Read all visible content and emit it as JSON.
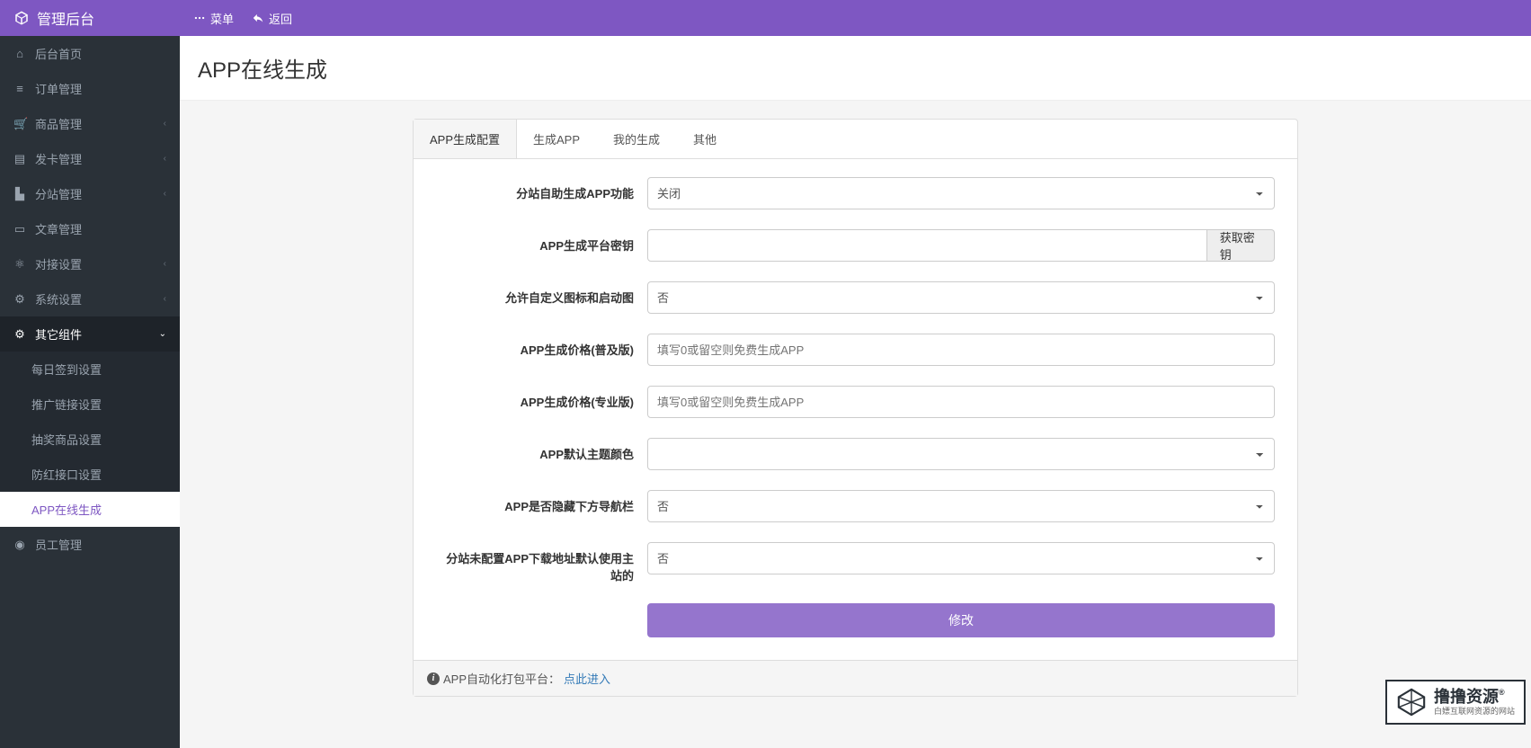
{
  "header": {
    "brand": "管理后台",
    "menu_btn": "菜单",
    "back_btn": "返回"
  },
  "sidebar": {
    "items": [
      {
        "label": "后台首页",
        "icon": "home"
      },
      {
        "label": "订单管理",
        "icon": "list"
      },
      {
        "label": "商品管理",
        "icon": "cart",
        "chev": true
      },
      {
        "label": "发卡管理",
        "icon": "card",
        "chev": true
      },
      {
        "label": "分站管理",
        "icon": "site",
        "chev": true
      },
      {
        "label": "文章管理",
        "icon": "doc"
      },
      {
        "label": "对接设置",
        "icon": "link",
        "chev": true
      },
      {
        "label": "系统设置",
        "icon": "gear",
        "chev": true
      },
      {
        "label": "其它组件",
        "icon": "cogs",
        "chev_down": true,
        "active": true
      },
      {
        "label": "员工管理",
        "icon": "user"
      }
    ],
    "sub_items": [
      {
        "label": "每日签到设置"
      },
      {
        "label": "推广链接设置"
      },
      {
        "label": "抽奖商品设置"
      },
      {
        "label": "防红接口设置"
      },
      {
        "label": "APP在线生成",
        "active": true
      }
    ]
  },
  "page": {
    "title": "APP在线生成"
  },
  "tabs": [
    {
      "label": "APP生成配置",
      "active": true
    },
    {
      "label": "生成APP"
    },
    {
      "label": "我的生成"
    },
    {
      "label": "其他"
    }
  ],
  "form": {
    "self_gen_label": "分站自助生成APP功能",
    "self_gen_value": "关闭",
    "key_label": "APP生成平台密钥",
    "key_value": "",
    "key_btn": "获取密钥",
    "custom_icon_label": "允许自定义图标和启动图",
    "custom_icon_value": "否",
    "price_basic_label": "APP生成价格(普及版)",
    "price_basic_placeholder": "填写0或留空则免费生成APP",
    "price_pro_label": "APP生成价格(专业版)",
    "price_pro_placeholder": "填写0或留空则免费生成APP",
    "theme_label": "APP默认主题颜色",
    "theme_value": "",
    "hide_nav_label": "APP是否隐藏下方导航栏",
    "hide_nav_value": "否",
    "fallback_label": "分站未配置APP下载地址默认使用主站的",
    "fallback_value": "否",
    "submit": "修改"
  },
  "footnote": {
    "prefix": "APP自动化打包平台：",
    "link": "点此进入"
  },
  "watermark": {
    "main": "撸撸资源",
    "r": "®",
    "sub": "白嫖互联网资源的网站"
  }
}
